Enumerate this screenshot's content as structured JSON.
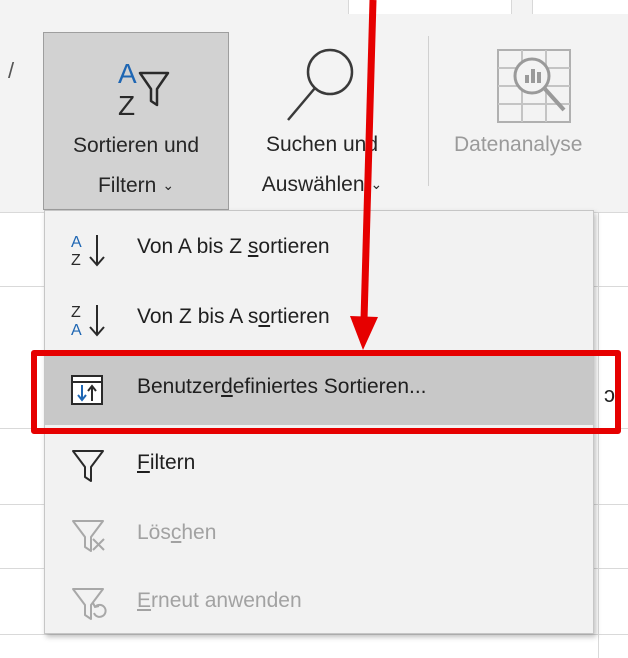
{
  "ribbon": {
    "sort_filter": {
      "line1": "Sortieren und",
      "line2": "Filtern",
      "icon": "sort-filter-icon"
    },
    "find_select": {
      "line1": "Suchen und",
      "line2": "Auswählen",
      "icon": "magnifier-icon"
    },
    "data_analysis": {
      "line1": "Datenanalyse",
      "icon": "data-analysis-icon"
    }
  },
  "menu": {
    "items": [
      {
        "pre": "Von A bis Z ",
        "u": "s",
        "post": "ortieren",
        "icon": "sort-a-to-z-icon",
        "enabled": true
      },
      {
        "pre": "Von Z bis A s",
        "u": "o",
        "post": "rtieren",
        "icon": "sort-z-to-a-icon",
        "enabled": true
      },
      {
        "pre": "Benutzer",
        "u": "d",
        "post": "efiniertes Sortieren...",
        "icon": "custom-sort-icon",
        "enabled": true,
        "highlighted": true
      },
      {
        "pre": "",
        "u": "F",
        "post": "iltern",
        "icon": "filter-icon",
        "enabled": true
      },
      {
        "pre": "Lös",
        "u": "c",
        "post": "hen",
        "icon": "clear-filter-icon",
        "enabled": false
      },
      {
        "pre": "",
        "u": "E",
        "post": "rneut anwenden",
        "icon": "reapply-filter-icon",
        "enabled": false
      }
    ]
  },
  "sheet": {
    "partial_text": "ɔ"
  },
  "annotation": {
    "color": "#e60000"
  },
  "colors": {
    "ribbon_bg": "#f3f3f3",
    "menu_bg": "#f2f2f2",
    "hover": "#c8c8c8",
    "icon_blue": "#1e66b3"
  }
}
